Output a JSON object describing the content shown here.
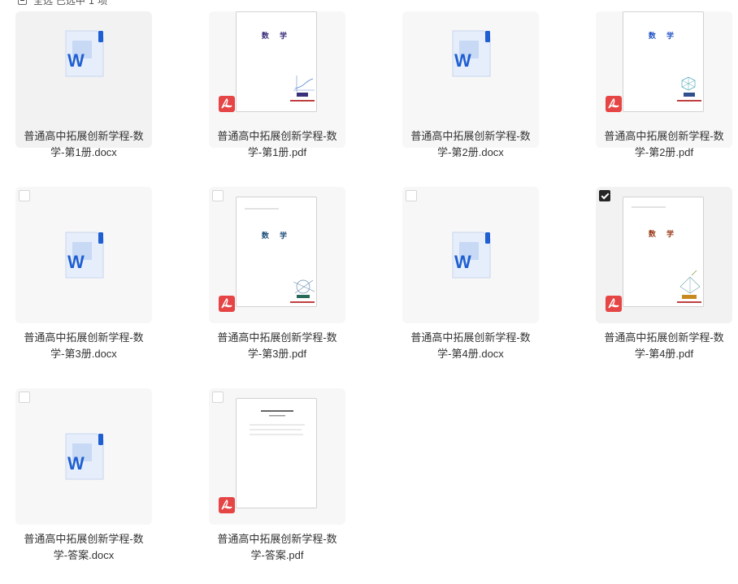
{
  "toolbar": {
    "select_all_label": "全选 已选中 1 项"
  },
  "files": [
    {
      "line1": "普通高中拓展创新学程-数",
      "line2": "学-第1册.docx",
      "type": "docx",
      "checked": false
    },
    {
      "line1": "普通高中拓展创新学程-数",
      "line2": "学-第1册.pdf",
      "type": "pdf",
      "checked": false,
      "cover_title": "数 学"
    },
    {
      "line1": "普通高中拓展创新学程-数",
      "line2": "学-第2册.docx",
      "type": "docx",
      "checked": false
    },
    {
      "line1": "普通高中拓展创新学程-数",
      "line2": "学-第2册.pdf",
      "type": "pdf",
      "checked": false,
      "cover_title": "数 学"
    },
    {
      "line1": "普通高中拓展创新学程-数",
      "line2": "学-第3册.docx",
      "type": "docx",
      "checked": false
    },
    {
      "line1": "普通高中拓展创新学程-数",
      "line2": "学-第3册.pdf",
      "type": "pdf",
      "checked": false,
      "cover_title": "数 学"
    },
    {
      "line1": "普通高中拓展创新学程-数",
      "line2": "学-第4册.docx",
      "type": "docx",
      "checked": false
    },
    {
      "line1": "普通高中拓展创新学程-数",
      "line2": "学-第4册.pdf",
      "type": "pdf",
      "checked": true,
      "cover_title": "数 学"
    },
    {
      "line1": "普通高中拓展创新学程-数",
      "line2": "学-答案.docx",
      "type": "docx",
      "checked": false
    },
    {
      "line1": "普通高中拓展创新学程-数",
      "line2": "学-答案.pdf",
      "type": "pdf",
      "checked": false
    }
  ],
  "colors": {
    "word_blue": "#1f5fd1",
    "pdf_red": "#e64545",
    "cover1": "#3a2f7a",
    "cover2": "#2456c8",
    "cover3": "#1f4f7a",
    "cover4": "#9a3c1a"
  },
  "icons": {
    "docx": "word-icon",
    "pdf": "acrobat-pdf-icon"
  }
}
